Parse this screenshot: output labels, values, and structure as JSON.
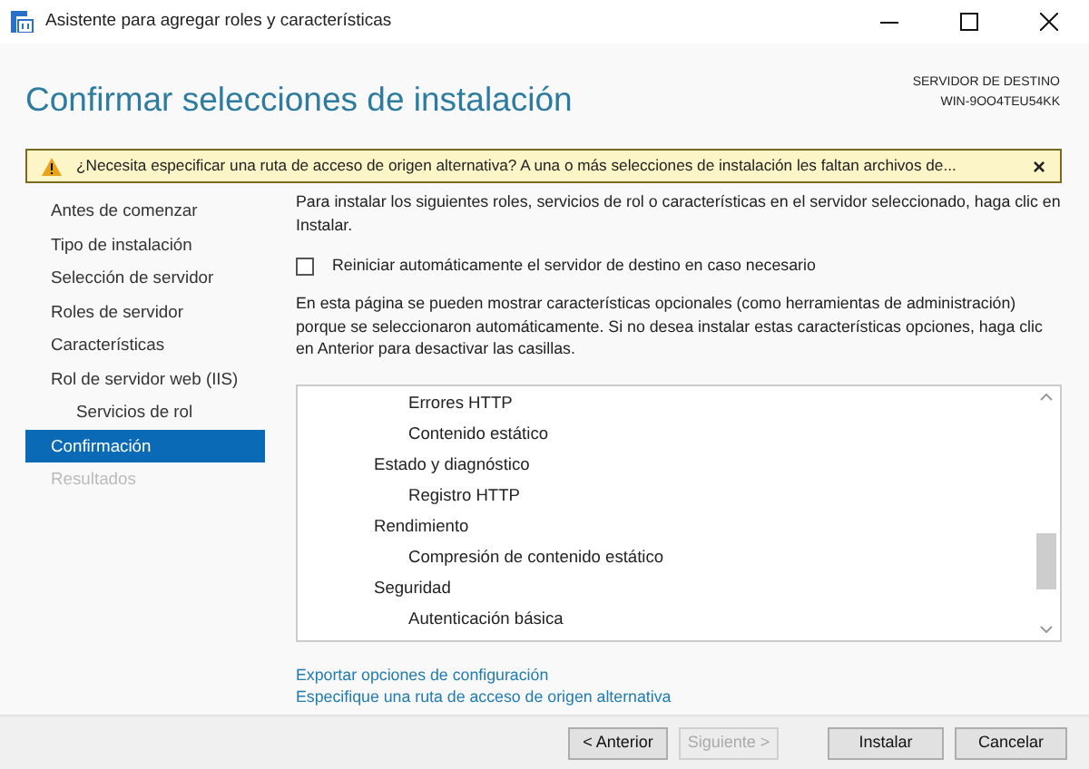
{
  "window": {
    "title": "Asistente para agregar roles y características"
  },
  "header": {
    "title": "Confirmar selecciones de instalación",
    "server_label": "SERVIDOR DE DESTINO",
    "server_name": "WIN-9OO4TEU54KK"
  },
  "warning": {
    "text": "¿Necesita especificar una ruta de acceso de origen alternativa? A una o más selecciones de instalación les faltan archivos de...",
    "close": "×"
  },
  "sidebar": {
    "items": [
      {
        "label": "Antes de comenzar",
        "selected": false,
        "disabled": false
      },
      {
        "label": "Tipo de instalación",
        "selected": false,
        "disabled": false
      },
      {
        "label": "Selección de servidor",
        "selected": false,
        "disabled": false
      },
      {
        "label": "Roles de servidor",
        "selected": false,
        "disabled": false
      },
      {
        "label": "Características",
        "selected": false,
        "disabled": false
      },
      {
        "label": "Rol de servidor web (IIS)",
        "selected": false,
        "disabled": false,
        "children": [
          {
            "label": "Servicios de rol",
            "selected": false,
            "disabled": false
          }
        ]
      },
      {
        "label": "Confirmación",
        "selected": true,
        "disabled": false
      },
      {
        "label": "Resultados",
        "selected": false,
        "disabled": true
      }
    ]
  },
  "intro": "Para instalar los siguientes roles, servicios de rol o características en el servidor seleccionado, haga clic en Instalar.",
  "restart_option": {
    "label": "Reiniciar automáticamente el servidor de destino en caso necesario",
    "checked": false
  },
  "note": "En esta página se pueden mostrar características opcionales (como herramientas de administración) porque se seleccionaron automáticamente. Si no desea instalar estas características opciones, haga clic en Anterior para desactivar las casillas.",
  "selections": {
    "items": [
      {
        "children": [
          {
            "label": "Errores HTTP"
          },
          {
            "label": "Contenido estático"
          }
        ]
      },
      {
        "label": "Estado y diagnóstico",
        "children": [
          {
            "label": "Registro HTTP"
          }
        ]
      },
      {
        "label": "Rendimiento",
        "children": [
          {
            "label": "Compresión de contenido estático"
          }
        ]
      },
      {
        "label": "Seguridad",
        "children": [
          {
            "label": "Autenticación básica"
          }
        ]
      }
    ]
  },
  "links": [
    "Exportar opciones de configuración",
    "Especifique una ruta de acceso de origen alternativa"
  ],
  "buttons": [
    {
      "label": "< Anterior",
      "disabled": false
    },
    {
      "label": "Siguiente >",
      "disabled": true
    },
    {
      "label": "Instalar",
      "disabled": false
    },
    {
      "label": "Cancelar",
      "disabled": false
    }
  ]
}
